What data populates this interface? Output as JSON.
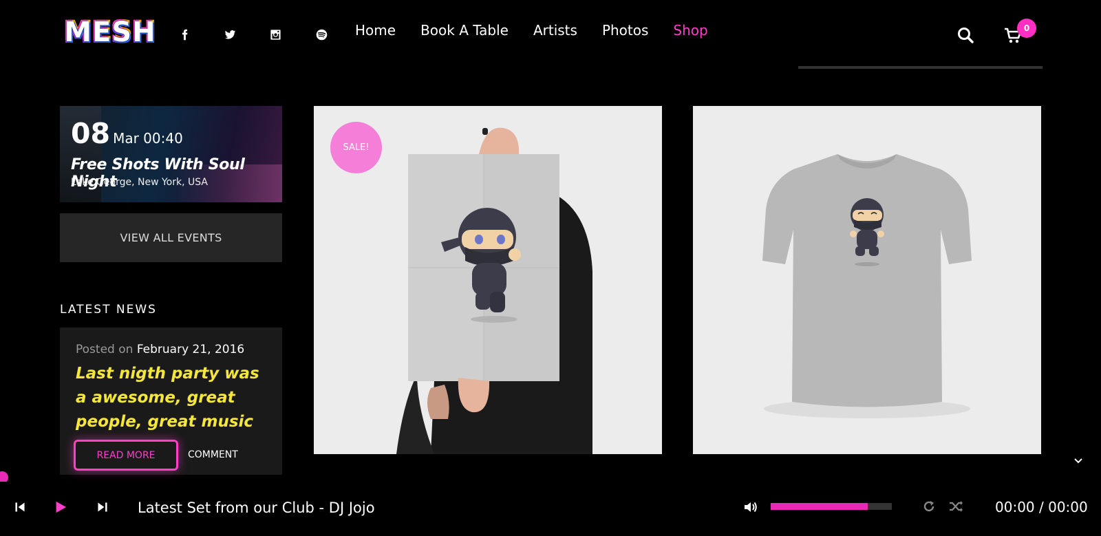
{
  "header": {
    "logo_text": "MESH",
    "social": [
      "facebook-icon",
      "twitter-icon",
      "instagram-icon",
      "spotify-icon"
    ],
    "nav": [
      {
        "label": "Home",
        "active": false
      },
      {
        "label": "Book A Table",
        "active": false
      },
      {
        "label": "Artists",
        "active": false
      },
      {
        "label": "Photos",
        "active": false
      },
      {
        "label": "Shop",
        "active": true
      }
    ],
    "cart_count": "0"
  },
  "sidebar": {
    "event": {
      "day": "08",
      "month_time": "Mar 00:40",
      "title": "Free Shots With Soul Night",
      "location": "Lake George, New York, USA"
    },
    "view_all_label": "VIEW ALL EVENTS",
    "latest_news_heading": "LATEST NEWS",
    "news": {
      "posted_prefix": "Posted on",
      "date": "February 21, 2016",
      "title": "Last nigth party was a awesome, great people, great music",
      "read_more": "READ MORE",
      "comment": "COMMENT"
    }
  },
  "products": [
    {
      "badge": "SALE!",
      "kind": "poster"
    },
    {
      "badge": "",
      "kind": "tshirt"
    }
  ],
  "player": {
    "track": "Latest Set from our Club - DJ Jojo",
    "time": "00:00 / 00:00",
    "volume_level": 0.8
  },
  "colors": {
    "accent": "#ff3ec9",
    "news_title": "#f5e63a",
    "background": "#000000"
  }
}
